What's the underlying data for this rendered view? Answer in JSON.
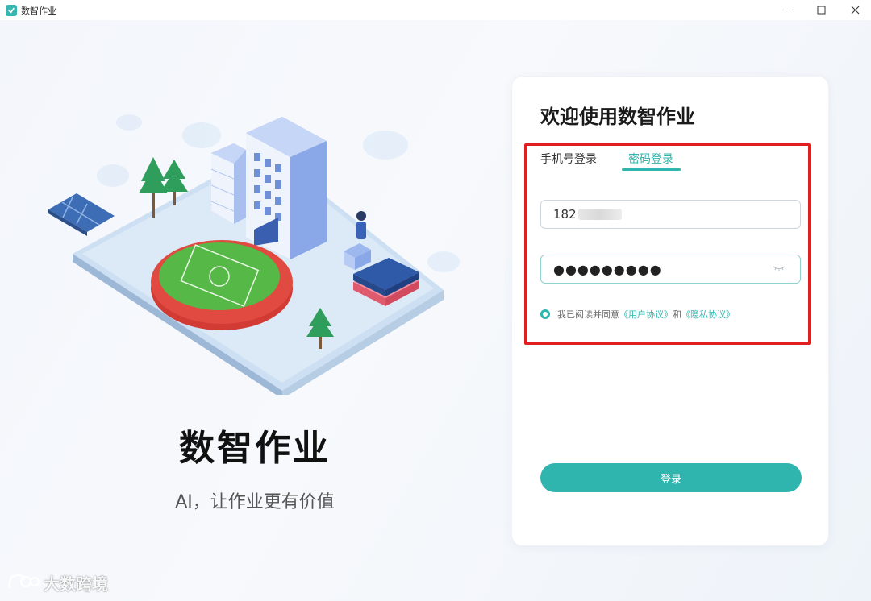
{
  "window": {
    "title": "数智作业"
  },
  "brand": {
    "title": "数智作业",
    "slogan": "AI，让作业更有价值"
  },
  "login": {
    "welcome": "欢迎使用数智作业",
    "tabs": [
      {
        "label": "手机号登录",
        "active": false
      },
      {
        "label": "密码登录",
        "active": true
      }
    ],
    "phone_value": "182",
    "password_value": "●●●●●●●●●",
    "agreement": {
      "prefix": "我已阅读并同意",
      "user_agreement": "《用户协议》",
      "conjunction": "和",
      "privacy_agreement": "《隐私协议》"
    },
    "submit_label": "登录"
  },
  "watermark": {
    "text": "大数跨境"
  },
  "colors": {
    "accent": "#2fb5ae",
    "highlight": "#e02020"
  }
}
